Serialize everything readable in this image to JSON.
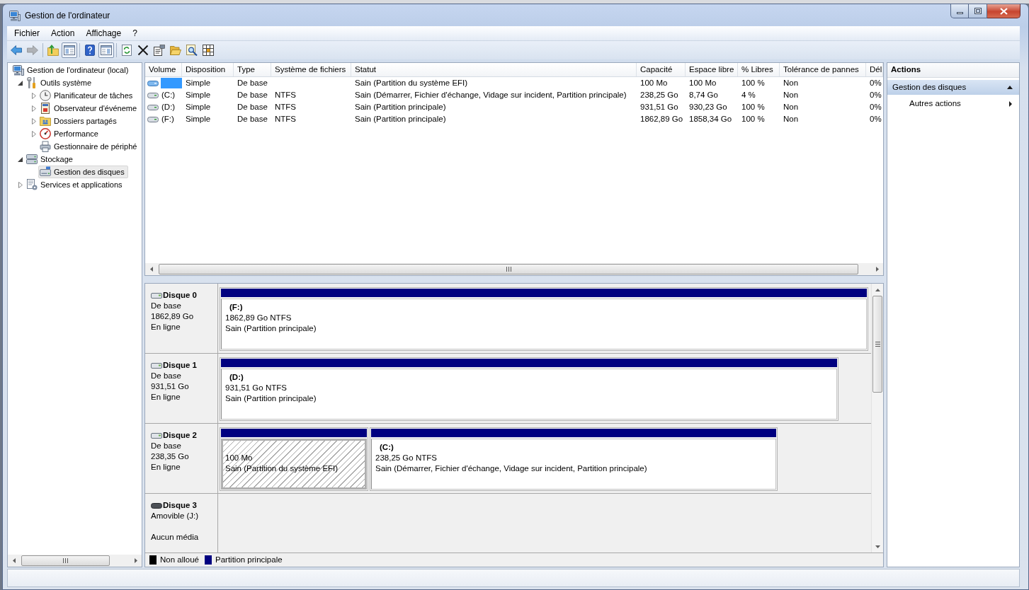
{
  "window": {
    "title": "Gestion de l'ordinateur"
  },
  "menu": [
    {
      "label": "Fichier"
    },
    {
      "label": "Action"
    },
    {
      "label": "Affichage"
    },
    {
      "label": "?"
    }
  ],
  "toolbar": [
    [
      {
        "disabled": false,
        "pressed": false
      },
      {
        "disabled": true,
        "pressed": false
      }
    ],
    [
      {
        "disabled": false,
        "pressed": false
      },
      {
        "disabled": false,
        "pressed": true
      }
    ],
    [
      {
        "disabled": false,
        "pressed": false
      },
      {
        "disabled": false,
        "pressed": true
      }
    ],
    [
      {
        "disabled": false,
        "pressed": false
      },
      {
        "disabled": false,
        "pressed": false
      },
      {
        "disabled": false,
        "pressed": false
      },
      {
        "disabled": false,
        "pressed": false
      },
      {
        "disabled": false,
        "pressed": false
      },
      {
        "disabled": false,
        "pressed": false
      }
    ]
  ],
  "tree": [
    {
      "label": "Gestion de l'ordinateur (local)",
      "selected": false,
      "children": [
        {
          "label": "Outils système",
          "expanded": true,
          "selected": false,
          "children": [
            {
              "label": "Planificateur de tâches",
              "expanded": false,
              "selected": false
            },
            {
              "label": "Observateur d'événeme",
              "expanded": false,
              "selected": false
            },
            {
              "label": "Dossiers partagés",
              "expanded": false,
              "selected": false
            },
            {
              "label": "Performance",
              "expanded": false,
              "selected": false
            },
            {
              "label": "Gestionnaire de périphé",
              "selected": false
            }
          ]
        },
        {
          "label": "Stockage",
          "expanded": true,
          "selected": false,
          "children": [
            {
              "label": "Gestion des disques",
              "selected": true
            }
          ]
        },
        {
          "label": "Services et applications",
          "expanded": false,
          "selected": false
        }
      ]
    }
  ],
  "volumes": {
    "columns": [
      "Volume",
      "Disposition",
      "Type",
      "Système de fichiers",
      "Statut",
      "Capacité",
      "Espace libre",
      "% Libres",
      "Tolérance de pannes",
      "Dél"
    ],
    "rows": [
      {
        "selected": true,
        "layout": "Simple",
        "type": "De base",
        "status": "Sain (Partition du système EFI)",
        "capacity": "100 Mo",
        "free_space": "100 Mo",
        "percent_free": "100 %",
        "fault_tolerance": "Non",
        "column_10": "0%"
      },
      {
        "selected": false,
        "volume": "(C:)",
        "layout": "Simple",
        "type": "De base",
        "file_system": "NTFS",
        "status": "Sain (Démarrer, Fichier d'échange, Vidage sur incident, Partition principale)",
        "capacity": "238,25 Go",
        "free_space": "8,74 Go",
        "percent_free": "4 %",
        "fault_tolerance": "Non",
        "column_10": "0%"
      },
      {
        "selected": false,
        "volume": "(D:)",
        "layout": "Simple",
        "type": "De base",
        "file_system": "NTFS",
        "status": "Sain (Partition principale)",
        "capacity": "931,51 Go",
        "free_space": "930,23 Go",
        "percent_free": "100 %",
        "fault_tolerance": "Non",
        "column_10": "0%"
      },
      {
        "selected": false,
        "volume": "(F:)",
        "layout": "Simple",
        "type": "De base",
        "file_system": "NTFS",
        "status": "Sain (Partition principale)",
        "capacity": "1862,89 Go",
        "free_space": "1858,34 Go",
        "percent_free": "100 %",
        "fault_tolerance": "Non",
        "column_10": "0%"
      }
    ]
  },
  "disks": [
    {
      "name": "Disque 0",
      "kind": "basic",
      "type": "De base",
      "size": "1862,89 Go",
      "status": "En ligne",
      "partitions": [
        {
          "label": "(F:)",
          "size": "1862,89 Go NTFS",
          "status": "Sain (Partition principale)",
          "selected": false
        }
      ]
    },
    {
      "name": "Disque 1",
      "kind": "basic",
      "type": "De base",
      "size": "931,51 Go",
      "status": "En ligne",
      "partitions": [
        {
          "label": "(D:)",
          "size": "931,51 Go NTFS",
          "status": "Sain (Partition principale)",
          "selected": false
        }
      ]
    },
    {
      "name": "Disque 2",
      "kind": "basic",
      "type": "De base",
      "size": "238,35 Go",
      "status": "En ligne",
      "partitions": [
        {
          "size": "100 Mo",
          "status": "Sain (Partition du système EFI)",
          "selected": true
        },
        {
          "label": "(C:)",
          "size": "238,25 Go NTFS",
          "status": "Sain (Démarrer, Fichier d'échange, Vidage sur incident, Partition principale)",
          "selected": false
        }
      ]
    },
    {
      "name": "Disque 3",
      "kind": "removable",
      "type": "Amovible (J:)",
      "status": "Aucun média"
    }
  ],
  "legend": [
    {
      "label": "Non alloué",
      "color": "#000000"
    },
    {
      "label": "Partition principale",
      "color": "#000080"
    }
  ],
  "actions": {
    "title": "Actions",
    "sections": [
      {
        "title": "Gestion des disques",
        "expanded": true,
        "items": [
          {
            "label": "Autres actions",
            "submenu": true
          }
        ]
      }
    ]
  }
}
